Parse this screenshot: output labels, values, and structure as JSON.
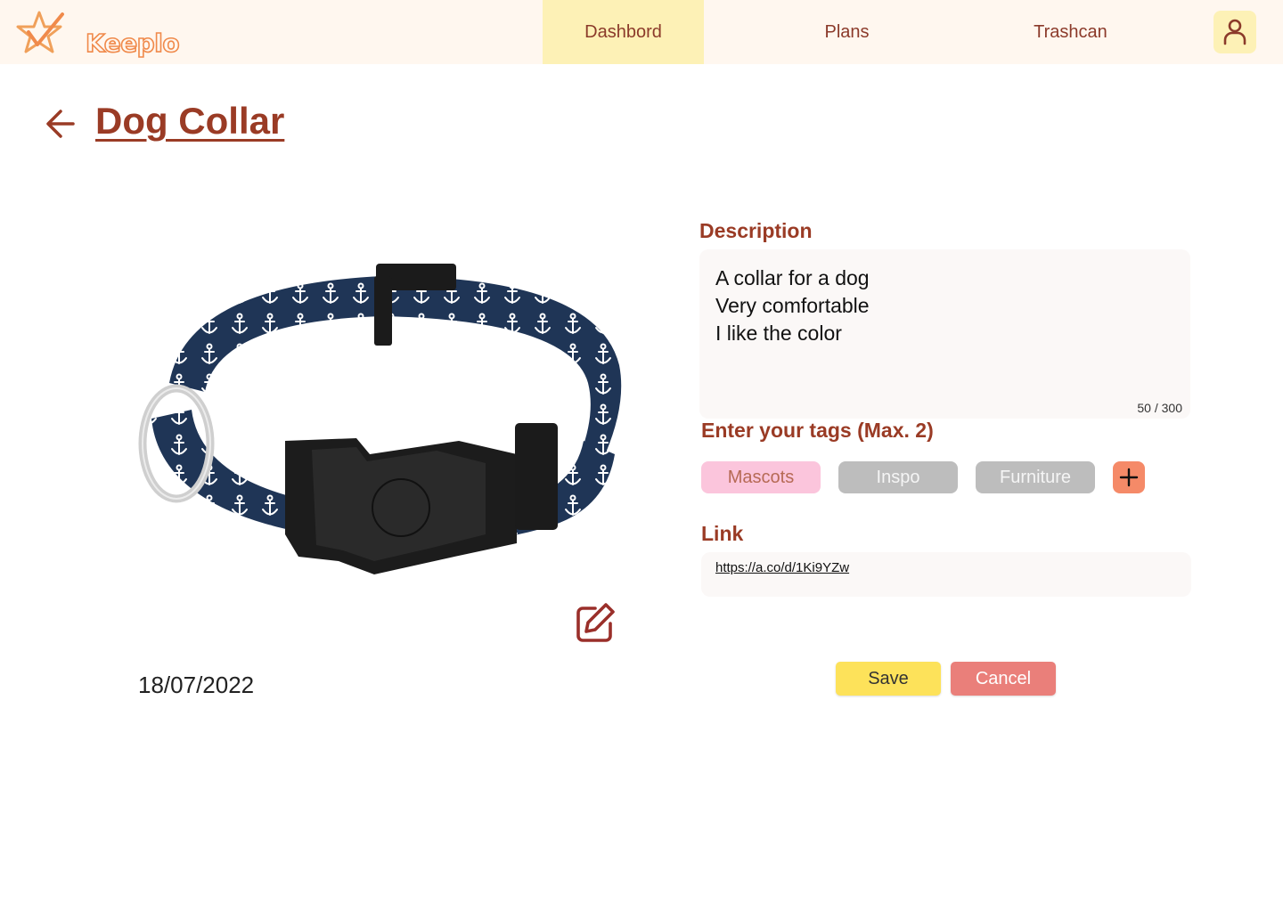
{
  "app": {
    "name": "Keeplo"
  },
  "nav": {
    "items": [
      {
        "label": "Dashbord",
        "active": true
      },
      {
        "label": "Plans",
        "active": false
      },
      {
        "label": "Trashcan",
        "active": false
      }
    ],
    "user_icon": "user-icon"
  },
  "page": {
    "title": "Dog Collar",
    "back_icon": "arrow-left-icon",
    "date": "18/07/2022",
    "image": "dog-collar-photo",
    "edit_icon": "edit-icon"
  },
  "form": {
    "description": {
      "label": "Description",
      "lines": [
        "A collar for a dog",
        "Very comfortable",
        "I like the color"
      ],
      "counter": "50 / 300"
    },
    "tags": {
      "label": "Enter your tags (Max. 2)",
      "items": [
        {
          "label": "Mascots",
          "selected": true
        },
        {
          "label": "Inspo",
          "selected": false
        },
        {
          "label": "Furniture",
          "selected": false
        }
      ],
      "add_icon": "plus-icon"
    },
    "link": {
      "label": "Link",
      "value": "https://a.co/d/1Ki9YZw"
    },
    "buttons": {
      "save": "Save",
      "cancel": "Cancel"
    }
  },
  "colors": {
    "accent": "#9a3b25",
    "nav_active": "#fdf1b6",
    "tag_selected": "#fbc5dc",
    "tag_unselected": "#bdbdbd",
    "add_tag": "#f58a68",
    "save": "#fde25a",
    "cancel": "#ea7f7a"
  }
}
